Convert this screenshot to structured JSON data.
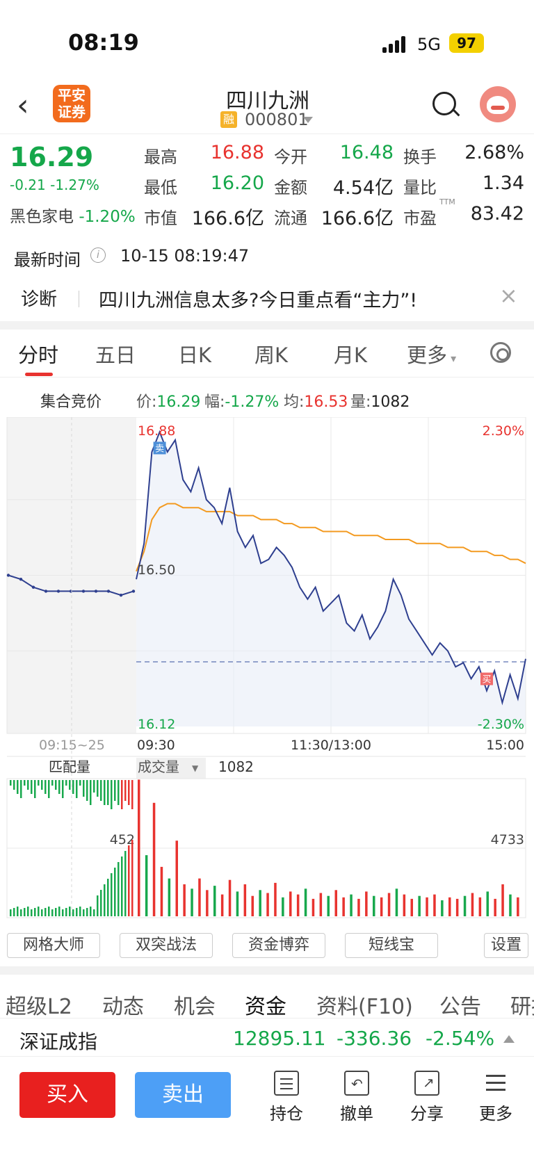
{
  "status_bar": {
    "time": "08:19",
    "network": "5G",
    "battery": "97"
  },
  "header": {
    "back_icon": "chevron-left-icon",
    "broker_logo": "平安\n证券",
    "stock_name": "四川九洲",
    "margin_badge": "融",
    "stock_code": "000801"
  },
  "quote": {
    "price": "16.29",
    "change": "-0.21 -1.27%",
    "sector_name": "黑色家电",
    "sector_change": "-1.20%",
    "fields": [
      {
        "label": "最高",
        "value": "16.88",
        "tone": "red"
      },
      {
        "label": "今开",
        "value": "16.48",
        "tone": "green"
      },
      {
        "label": "换手",
        "value": "2.68%",
        "tone": "neutral"
      },
      {
        "label": "最低",
        "value": "16.20",
        "tone": "green"
      },
      {
        "label": "金额",
        "value": "4.54亿",
        "tone": "neutral"
      },
      {
        "label": "量比",
        "value": "1.34",
        "tone": "neutral"
      },
      {
        "label": "市值",
        "value": "166.6亿",
        "tone": "neutral"
      },
      {
        "label": "流通",
        "value": "166.6亿",
        "tone": "neutral"
      },
      {
        "label": "市盈",
        "value": "83.42",
        "tone": "neutral"
      }
    ],
    "pe_tag": "TTM"
  },
  "latest": {
    "label": "最新时间",
    "value": "10-15 08:19:47"
  },
  "diagnosis": {
    "label": "诊断",
    "text": "四川九洲信息太多?今日重点看“主力”!"
  },
  "tabs": [
    "分时",
    "五日",
    "日K",
    "周K",
    "月K",
    "更多"
  ],
  "info_bar": {
    "auction": "集合竞价",
    "price_label": "价:",
    "price": "16.29",
    "amp_label": "幅:",
    "amp": "-1.27%",
    "avg_label": "均:",
    "avg": "16.53",
    "vol_label": "量:",
    "vol": "1082"
  },
  "chart_data": {
    "type": "line",
    "y_top_label": "16.88",
    "y_mid_label": "16.50",
    "y_bottom_label": "16.12",
    "pct_top": "2.30%",
    "pct_bottom": "-2.30%",
    "ylim": [
      16.12,
      16.88
    ],
    "prev_close": 16.5,
    "x_labels": [
      "09:15~25",
      "09:30",
      "11:30/13:00",
      "15:00"
    ],
    "auction_price": [
      16.5,
      16.49,
      16.47,
      16.46,
      16.46,
      16.46,
      16.46,
      16.46,
      16.46,
      16.45,
      16.46
    ],
    "series": [
      {
        "name": "价",
        "color": "#2e3f8f",
        "values": [
          16.49,
          16.58,
          16.81,
          16.86,
          16.81,
          16.84,
          16.74,
          16.71,
          16.77,
          16.69,
          16.67,
          16.63,
          16.72,
          16.61,
          16.57,
          16.6,
          16.53,
          16.54,
          16.57,
          16.55,
          16.52,
          16.47,
          16.44,
          16.47,
          16.41,
          16.43,
          16.45,
          16.38,
          16.36,
          16.4,
          16.34,
          16.37,
          16.41,
          16.49,
          16.45,
          16.39,
          16.36,
          16.33,
          16.3,
          16.33,
          16.31,
          16.27,
          16.28,
          16.24,
          16.27,
          16.21,
          16.26,
          16.18,
          16.25,
          16.19,
          16.29
        ]
      },
      {
        "name": "均",
        "color": "#f39a20",
        "values": [
          16.51,
          16.56,
          16.64,
          16.67,
          16.68,
          16.68,
          16.67,
          16.67,
          16.67,
          16.66,
          16.66,
          16.66,
          16.66,
          16.65,
          16.65,
          16.65,
          16.64,
          16.64,
          16.64,
          16.63,
          16.63,
          16.62,
          16.62,
          16.62,
          16.61,
          16.61,
          16.61,
          16.61,
          16.6,
          16.6,
          16.6,
          16.6,
          16.59,
          16.59,
          16.59,
          16.59,
          16.58,
          16.58,
          16.58,
          16.58,
          16.57,
          16.57,
          16.57,
          16.56,
          16.56,
          16.56,
          16.55,
          16.55,
          16.54,
          16.54,
          16.53
        ]
      }
    ],
    "markers": [
      {
        "label": "卖",
        "index": 3
      },
      {
        "label": "买",
        "index": 45
      }
    ],
    "volume": {
      "label_left": "匹配量",
      "selector": "成交量",
      "current": "1082",
      "left_mark": "452",
      "right_mark": "4733",
      "ylim": [
        0,
        9466
      ],
      "values": [
        9400,
        4200,
        7800,
        3400,
        2600,
        5200,
        2200,
        1900,
        2600,
        1800,
        2100,
        1500,
        2500,
        1700,
        2200,
        1400,
        1800,
        1600,
        2300,
        1300,
        1700,
        1500,
        1900,
        1200,
        1600,
        1400,
        1800,
        1300,
        1500,
        1200,
        1700,
        1400,
        1300,
        1600,
        1900,
        1500,
        1200,
        1400,
        1300,
        1500,
        1100,
        1300,
        1200,
        1400,
        1600,
        1300,
        1700,
        1200,
        2200,
        1500,
        1300
      ]
    }
  },
  "tools": [
    "网格大师",
    "双突战法",
    "资金博弈",
    "短线宝",
    "设置"
  ],
  "sub_tabs": [
    "超级L2",
    "动态",
    "机会",
    "资金",
    "资料(F10)",
    "公告",
    "研报"
  ],
  "index": {
    "name": "深证成指",
    "value": "12895.11",
    "change": "-336.36",
    "pct": "-2.54%"
  },
  "bottom": {
    "buy": "买入",
    "sell": "卖出",
    "nav": [
      "持仓",
      "撤单",
      "分享",
      "更多"
    ]
  }
}
